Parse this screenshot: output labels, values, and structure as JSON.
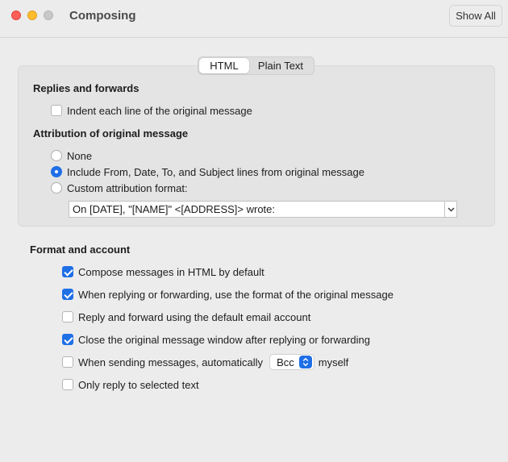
{
  "window": {
    "title": "Composing",
    "show_all_label": "Show All"
  },
  "tabs": [
    {
      "label": "HTML",
      "active": true
    },
    {
      "label": "Plain Text",
      "active": false
    }
  ],
  "replies_section": {
    "heading": "Replies and forwards",
    "indent_label": "Indent each line of the original message",
    "indent_checked": false
  },
  "attribution_section": {
    "heading": "Attribution of original message",
    "options": [
      {
        "label": "None",
        "selected": false
      },
      {
        "label": "Include From, Date, To, and Subject lines from original message",
        "selected": true
      },
      {
        "label": "Custom attribution format:",
        "selected": false
      }
    ],
    "custom_format_value": "On [DATE], \"[NAME]\" <[ADDRESS]> wrote:"
  },
  "format_section": {
    "heading": "Format and account",
    "options": [
      {
        "label": "Compose messages in HTML by default",
        "checked": true
      },
      {
        "label": "When replying or forwarding, use the format of the original message",
        "checked": true
      },
      {
        "label": "Reply and forward using the default email account",
        "checked": false
      },
      {
        "label": "Close the original message window after replying or forwarding",
        "checked": true
      },
      {
        "label": "When sending messages, automatically",
        "checked": false,
        "suffix": "myself",
        "select_value": "Bcc"
      },
      {
        "label": "Only reply to selected text",
        "checked": false
      }
    ]
  },
  "colors": {
    "accent": "#1f6fe6",
    "close": "#fe5f57",
    "minimize": "#febc2e",
    "zoom_disabled": "#c8c8c8"
  }
}
